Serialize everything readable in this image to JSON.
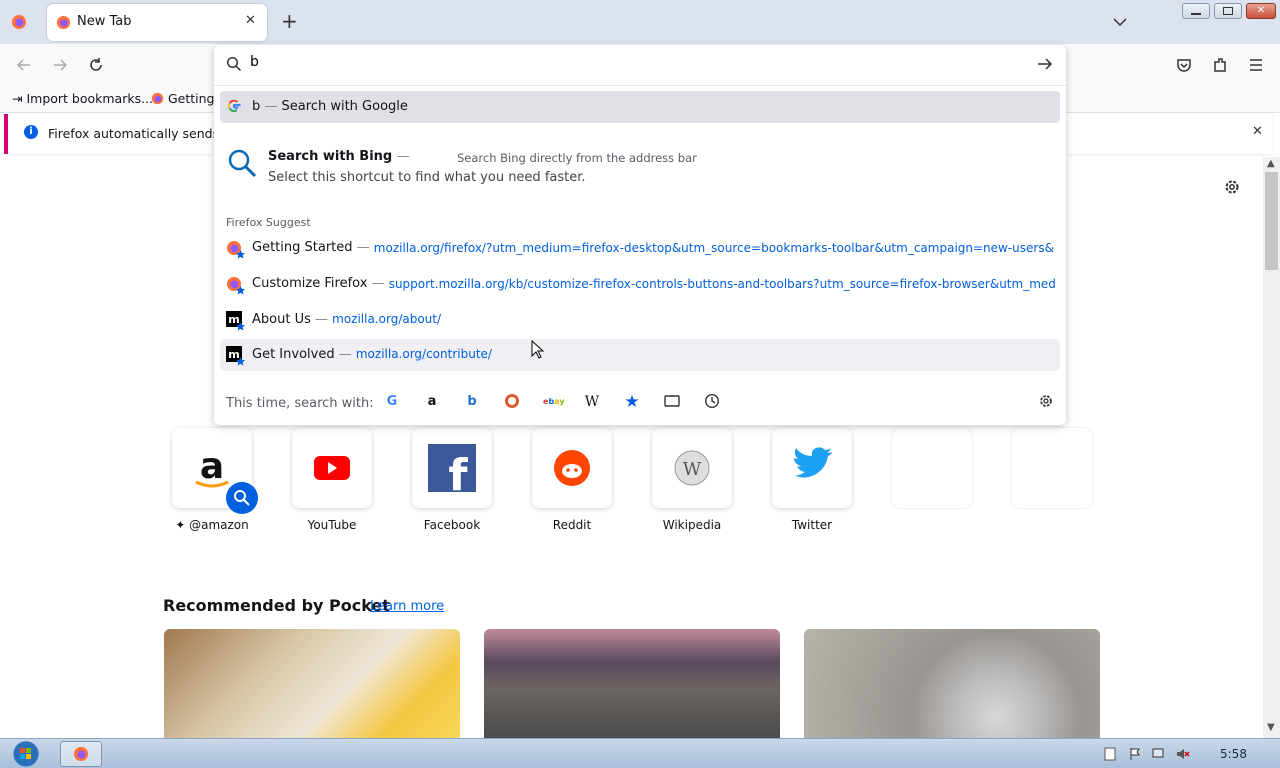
{
  "tab": {
    "title": "New Tab",
    "close": "✕"
  },
  "newtab": "+",
  "bookmarks": {
    "import": "Import bookmarks...",
    "getting_started": "Getting"
  },
  "notification": {
    "text": "Firefox automatically sends som",
    "close": "✕"
  },
  "urlbar": {
    "value": "b",
    "google_row": {
      "prefix": "b",
      "sep": "—",
      "label": "Search with Google"
    },
    "bing": {
      "title": "Search with Bing",
      "sep": "—",
      "subtitle": "Select this shortcut to find what you need faster.",
      "side": "Search Bing directly from the address bar"
    },
    "suggest_header": "Firefox Suggest",
    "suggestions": [
      {
        "title": "Getting Started",
        "sep": "—",
        "url": "mozilla.org/firefox/?utm_medium=firefox-desktop&utm_source=bookmarks-toolbar&utm_campaign=new-users&utm_content"
      },
      {
        "title": "Customize Firefox",
        "sep": "—",
        "url": "support.mozilla.org/kb/customize-firefox-controls-buttons-and-toolbars?utm_source=firefox-browser&utm_medium=defaul"
      },
      {
        "title": "About Us",
        "sep": "—",
        "url": "mozilla.org/about/"
      },
      {
        "title": "Get Involved",
        "sep": "—",
        "url": "mozilla.org/contribute/"
      }
    ],
    "oneoff_label": "This time, search with:"
  },
  "top_sites": [
    {
      "label": "@amazon"
    },
    {
      "label": "YouTube"
    },
    {
      "label": "Facebook"
    },
    {
      "label": "Reddit"
    },
    {
      "label": "Wikipedia"
    },
    {
      "label": "Twitter"
    }
  ],
  "pocket": {
    "title": "Recommended by Pocket",
    "learn_more": "Learn more"
  },
  "taskbar": {
    "clock": "5:58"
  },
  "colors": {
    "accent": "#0060df",
    "tabstrip": "#dce3ef",
    "notif_border": "#d50277"
  },
  "icons": [
    "firefox-icon",
    "search-icon",
    "arrow-right-icon",
    "back-icon",
    "forward-icon",
    "reload-icon",
    "pocket-icon",
    "extensions-icon",
    "hamburger-icon",
    "gear-icon",
    "info-icon",
    "close-icon",
    "chevron-down-icon",
    "windows-start-icon"
  ]
}
